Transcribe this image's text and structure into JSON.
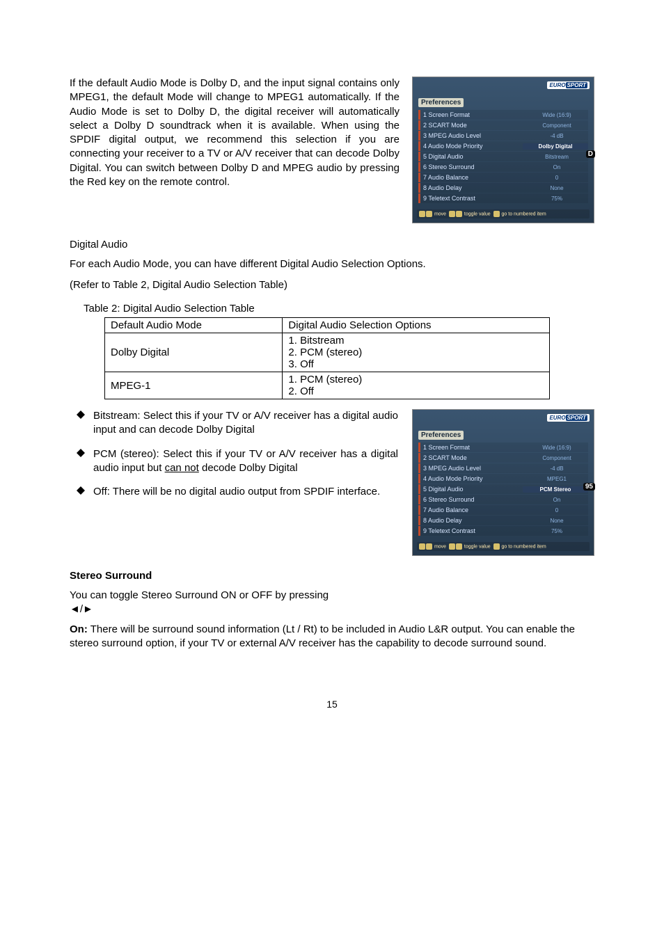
{
  "intro_paragraph": "If the default Audio Mode is Dolby D, and the input signal contains only MPEG1, the default Mode will change to MPEG1 automatically.  If the Audio Mode is set to Dolby D, the digital receiver will automatically select a Dolby D soundtrack when it is available.  When using the SPDIF digital output, we recommend this selection if you are connecting your receiver to a TV or A/V receiver that can decode Dolby Digital. You can switch between Dolby D and MPEG audio by pressing the Red key on the remote control.",
  "digital_audio_heading": "Digital Audio",
  "digital_audio_para1": "For each Audio Mode, you can have different Digital Audio Selection Options.",
  "digital_audio_para2": "(Refer to Table 2, Digital Audio Selection Table)",
  "table_caption": "Table 2: Digital Audio Selection Table",
  "table": {
    "headers": [
      "Default  Audio Mode",
      "Digital Audio Selection Options"
    ],
    "rows": [
      {
        "mode": "Dolby Digital",
        "options": "1. Bitstream\n2. PCM (stereo)\n3. Off"
      },
      {
        "mode": "MPEG-1",
        "options": "1. PCM (stereo)\n2. Off"
      }
    ]
  },
  "options": {
    "bitstream": "Bitstream: Select this if your TV or A/V receiver has a digital audio input and can decode Dolby Digital",
    "pcm_pre": "PCM (stereo): Select this if your TV or A/V receiver has a digital audio input but ",
    "pcm_underlined": "can not",
    "pcm_post": " decode Dolby Digital",
    "off": "Off: There will be no digital audio output from SPDIF interface."
  },
  "stereo_surround_heading": "Stereo Surround",
  "stereo_para1": "You can toggle Stereo Surround ON or OFF by pressing",
  "arrows_glyph": "◄/►",
  "stereo_on_label": "On:",
  "stereo_on_text": " There will be surround sound information (Lt / Rt) to be included in Audio L&R output. You can enable the stereo surround option, if your TV or external A/V receiver has the capability to decode surround sound.",
  "page_number": "15",
  "screenshot1": {
    "logo_a": "EURO",
    "logo_b": "SPORT",
    "title": "Preferences",
    "rows": [
      {
        "label": "1 Screen Format",
        "value": "Wide (16:9)",
        "hl": false
      },
      {
        "label": "2 SCART Mode",
        "value": "Component",
        "hl": false
      },
      {
        "label": "3 MPEG Audio Level",
        "value": "-4 dB",
        "hl": false
      },
      {
        "label": "4 Audio Mode Priority",
        "value": "Dolby Digital",
        "hl": true
      },
      {
        "label": "5 Digital Audio",
        "value": "Bitstream",
        "hl": false
      },
      {
        "label": "6 Stereo Surround",
        "value": "On",
        "hl": false
      },
      {
        "label": "7 Audio Balance",
        "value": "0",
        "hl": false
      },
      {
        "label": "8 Audio Delay",
        "value": "None",
        "hl": false
      },
      {
        "label": "9 Teletext Contrast",
        "value": "75%",
        "hl": false
      }
    ],
    "footer_move": "move",
    "footer_toggle": "toggle value",
    "footer_goto": "go to numbered item",
    "side_badge": "D"
  },
  "screenshot2": {
    "logo_a": "EURO",
    "logo_b": "SPORT",
    "title": "Preferences",
    "rows": [
      {
        "label": "1 Screen Format",
        "value": "Wide (16:9)",
        "hl": false
      },
      {
        "label": "2 SCART Mode",
        "value": "Component",
        "hl": false
      },
      {
        "label": "3 MPEG Audio Level",
        "value": "-4 dB",
        "hl": false
      },
      {
        "label": "4 Audio Mode Priority",
        "value": "MPEG1",
        "hl": false
      },
      {
        "label": "5 Digital Audio",
        "value": "PCM Stereo",
        "hl": true
      },
      {
        "label": "6 Stereo Surround",
        "value": "On",
        "hl": false
      },
      {
        "label": "7 Audio Balance",
        "value": "0",
        "hl": false
      },
      {
        "label": "8 Audio Delay",
        "value": "None",
        "hl": false
      },
      {
        "label": "9 Teletext Contrast",
        "value": "75%",
        "hl": false
      }
    ],
    "footer_move": "move",
    "footer_toggle": "toggle value",
    "footer_goto": "go to numbered item",
    "side_badge": "95"
  }
}
